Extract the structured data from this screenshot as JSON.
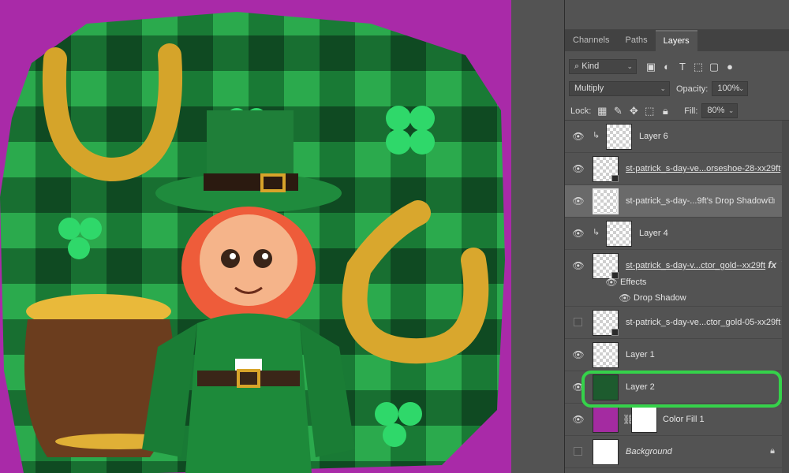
{
  "panel": {
    "tabs": [
      {
        "label": "Channels"
      },
      {
        "label": "Paths"
      },
      {
        "label": "Layers"
      }
    ],
    "filter": {
      "kind_label": "Kind"
    },
    "blend_mode": "Multiply",
    "opacity_label": "Opacity:",
    "opacity_value": "100%",
    "lock_label": "Lock:",
    "fill_label": "Fill:",
    "fill_value": "80%"
  },
  "layers": [
    {
      "name": "Layer 6"
    },
    {
      "name": "st-patrick_s-day-ve...orseshoe-28-xx29ft"
    },
    {
      "name": "st-patrick_s-day-...9ft's Drop Shadow"
    },
    {
      "name": "Layer 4"
    },
    {
      "name": "st-patrick_s-day-v...ctor_gold--xx29ft"
    },
    {
      "name": "st-patrick_s-day-ve...ctor_gold-05-xx29ft"
    },
    {
      "name": "Layer 1"
    },
    {
      "name": "Layer 2"
    },
    {
      "name": "Color Fill 1"
    },
    {
      "name": "Background"
    }
  ],
  "effects": {
    "label": "Effects",
    "drop_shadow": "Drop Shadow"
  },
  "fx_label": "fx",
  "colors": {
    "canvas_bg": "#a92aa8",
    "plaid_green": "#1f8a3c",
    "gold": "#d8a42a",
    "highlight": "#35d24a"
  }
}
